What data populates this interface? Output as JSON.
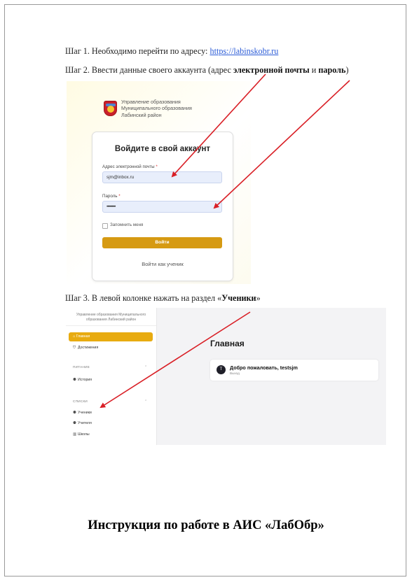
{
  "step1": {
    "prefix": "Шаг 1. Необходимо перейти по адресу: ",
    "link": "https://labinskobr.ru"
  },
  "step2": {
    "prefix": "Шаг 2. Ввести данные своего аккаунта (адрес ",
    "bold1": "электронной почты",
    "mid": " и ",
    "bold2": "пароль",
    "suffix": ")"
  },
  "step3": {
    "prefix": "Шаг 3. В левой колонке нажать на раздел «",
    "bold": "Ученики",
    "suffix": "»"
  },
  "login": {
    "org_line1": "Управление образования",
    "org_line2": "Муниципального образования",
    "org_line3": "Лабинский район",
    "title": "Войдите в свой аккаунт",
    "email_label": "Адрес электронной почты",
    "email_value": "sjm@inbox.ru",
    "password_label": "Пароль",
    "password_value": "••••••••••",
    "required_mark": "*",
    "remember_label": "Запомнить меня",
    "login_button": "Войти",
    "student_link": "Войти как ученик"
  },
  "dashboard": {
    "org_line1": "Управление образования Муниципального",
    "org_line2": "образования Лабинский район",
    "nav_home": "Главная",
    "nav_achievements": "Достижения",
    "section_food": "ПИТАНИЕ",
    "nav_history": "История",
    "section_lists": "СПИСКИ",
    "nav_students": "Ученики",
    "nav_teachers": "Учителя",
    "nav_schools": "Школы",
    "page_title": "Главная",
    "welcome": "Добро пожаловать, testsjm",
    "logout": "Выход",
    "avatar_letter": "T"
  },
  "doc_title": "Инструкция по работе в АИС «ЛабОбр»",
  "colors": {
    "accent": "#d69a12",
    "arrow": "#d91f26",
    "link": "#2a5bd7"
  }
}
